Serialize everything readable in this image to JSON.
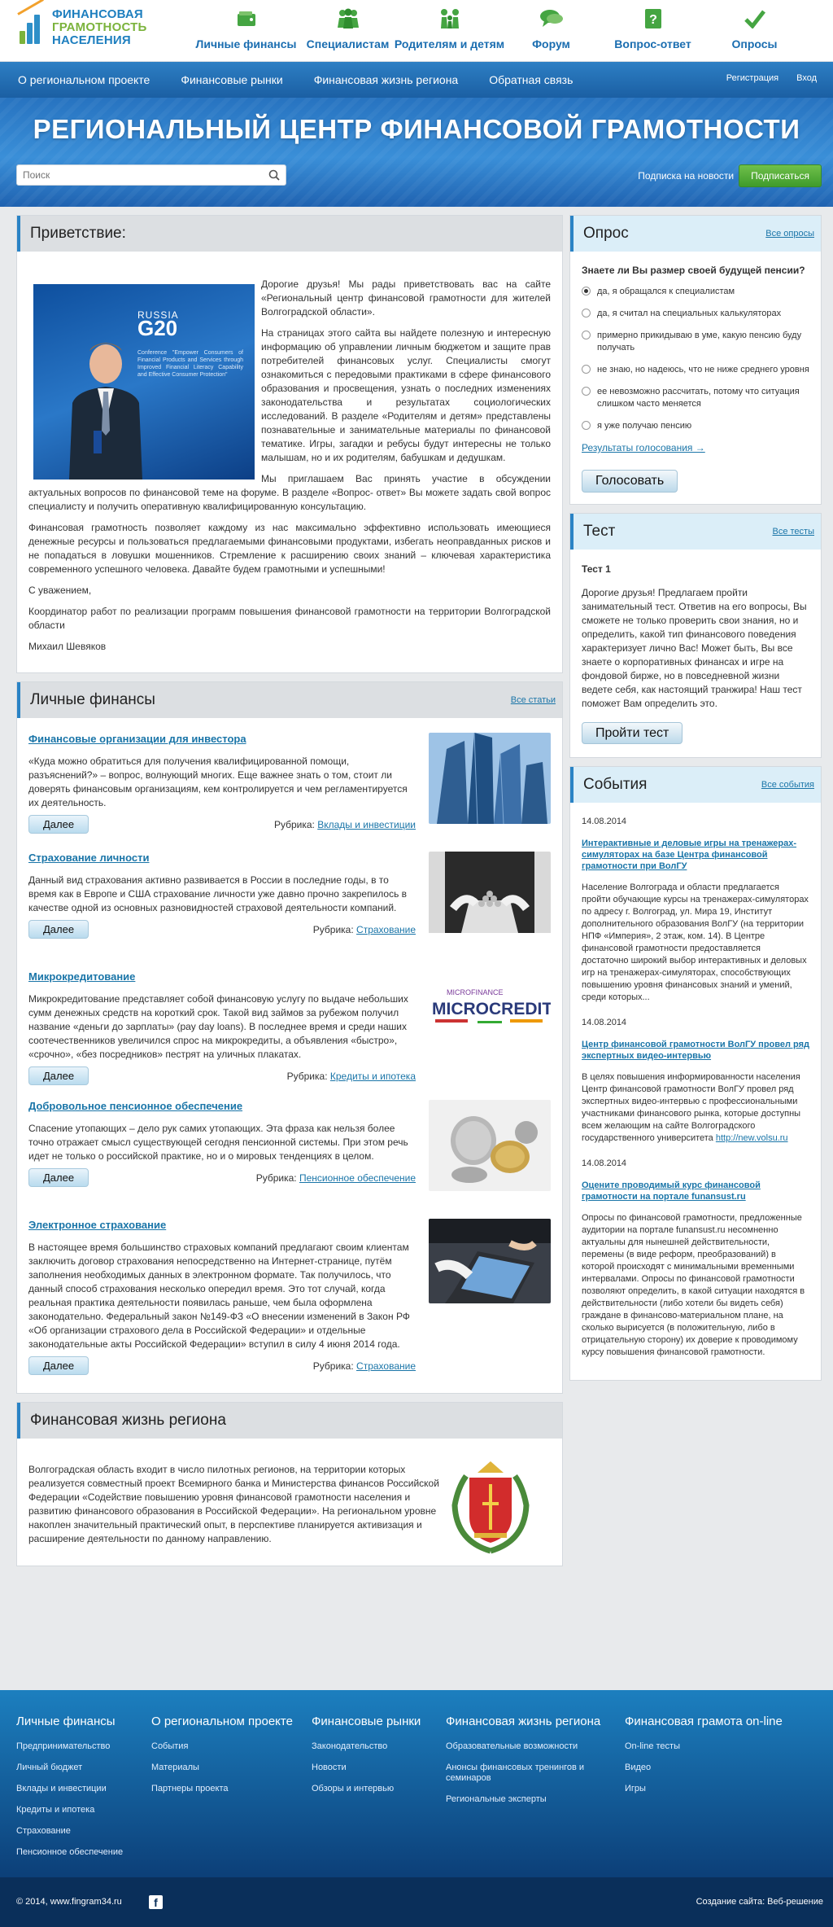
{
  "logo": {
    "line1": "ФИНАНСОВАЯ",
    "line2": "ГРАМОТНОСТЬ",
    "line3": "НАСЕЛЕНИЯ"
  },
  "topnav": [
    {
      "label": "Личные финансы",
      "icon": "wallet-icon"
    },
    {
      "label": "Специалистам",
      "icon": "people-group-icon"
    },
    {
      "label": "Родителям и детям",
      "icon": "family-icon"
    },
    {
      "label": "Форум",
      "icon": "chat-icon"
    },
    {
      "label": "Вопрос-ответ",
      "icon": "question-icon"
    },
    {
      "label": "Опросы",
      "icon": "checkmark-icon"
    }
  ],
  "navbar": {
    "items": [
      "О региональном проекте",
      "Финансовые рынки",
      "Финансовая жизнь региона",
      "Обратная связь"
    ],
    "register": "Регистрация",
    "login": "Вход"
  },
  "banner": {
    "title": "РЕГИОНАЛЬНЫЙ ЦЕНТР ФИНАНСОВОЙ ГРАМОТНОСТИ",
    "search_placeholder": "Поиск",
    "subscribe_label": "Подписка на новости",
    "subscribe_button": "Подписаться"
  },
  "welcome": {
    "title": "Приветствие:",
    "photo": {
      "rus": "RUSSIA",
      "g20": "G20",
      "conf": "Conference \"Empower Consumers of Financial Products and Services through Improved Financial Literacy Capability and Effective Consumer Protection\""
    },
    "p1": "Дорогие друзья! Мы рады приветствовать вас на сайте «Региональный центр финансовой грамотности для жителей Волгоградской области».",
    "p2": "На страницах этого сайта вы найдете полезную и интересную информацию об управлении личным бюджетом и защите прав потребителей финансовых услуг. Специалисты смогут ознакомиться с передовыми практиками в сфере финансового образования и просвещения, узнать о последних изменениях законодательства и результатах социологических исследований. В разделе «Родителям и детям» представлены познавательные и занимательные материалы по финансовой тематике. Игры, загадки и ребусы будут интересны не только малышам, но и их родителям, бабушкам и дедушкам.",
    "p3": "Мы приглашаем Вас принять участие в обсуждении актуальных вопросов по финансовой теме на форуме. В разделе «Вопрос- ответ» Вы можете задать свой вопрос специалисту и получить оперативную квалифицированную консультацию.",
    "p4": "Финансовая грамотность позволяет каждому из нас максимально эффективно использовать имеющиеся денежные ресурсы и пользоваться предлагаемыми финансовыми продуктами, избегать неоправданных рисков и не попадаться в ловушки мошенников. Стремление к расширению своих знаний – ключевая характеристика современного успешного человека. Давайте будем грамотными и успешными!",
    "p5": "С уважением,",
    "p6": "Координатор работ по реализации программ повышения финансовой грамотности на территории Волгоградской области",
    "p7": "Михаил Шевяков"
  },
  "personal": {
    "title": "Личные финансы",
    "all": "Все статьи",
    "more": "Далее",
    "rubric_label": "Рубрика:",
    "articles": [
      {
        "title": "Финансовые организации для инвестора",
        "text": "«Куда можно обратиться для получения квалифицированной помощи, разъяснений?» – вопрос, волнующий многих. Еще важнее знать о том, стоит ли доверять финансовым организациям, кем контролируется и чем регламентируется их деятельность.",
        "rubric": "Вклады и инвестиции"
      },
      {
        "title": "Страхование личности",
        "text": "Данный вид страхования активно развивается в России в последние годы, в то время как в Европе и США страхование личности уже давно прочно закрепилось в качестве одной из основных разновидностей страховой деятельности компаний.",
        "rubric": "Страхование"
      },
      {
        "title": "Микрокредитование",
        "text": "Микрокредитование представляет собой финансовую услугу по выдаче небольших сумм денежных средств на короткий срок. Такой вид займов за рубежом получил название «деньги до зарплаты» (pay day loans). В последнее время и среди наших соотечественников увеличился спрос на микрокредиты, а объявления «быстро», «срочно», «без посредников» пестрят на уличных плакатах.",
        "rubric": "Кредиты и ипотека",
        "img_text1": "MICROFINANCE",
        "img_text2": "MICROCREDIT"
      },
      {
        "title": "Добровольное пенсионное обеспечение",
        "text": "Спасение утопающих – дело рук самих утопающих. Эта фраза как нельзя более точно отражает смысл существующей сегодня пенсионной системы. При этом речь идет не только о российской практике, но и о мировых тенденциях в целом.",
        "rubric": "Пенсионное обеспечение"
      },
      {
        "title": "Электронное страхование",
        "text": "В настоящее время большинство страховых компаний предлагают своим клиентам заключить договор страхования непосредственно на Интернет-странице, путём заполнения необходимых данных в электронном формате. Так получилось, что данный способ страхования несколько опередил время. Это тот случай, когда реальная практика деятельности появилась раньше, чем была оформлена законодательно. Федеральный закон №149-ФЗ «О внесении изменений в Закон РФ «Об организации страхового дела в Российской Федерации» и отдельные законодательные акты Российской Федерации» вступил в силу 4 июня 2014 года.",
        "rubric": "Страхование"
      }
    ]
  },
  "region": {
    "title": "Финансовая жизнь региона",
    "text": "Волгоградская область входит в число пилотных регионов, на территории которых реализуется совместный проект Всемирного банка и Министерства финансов Российской Федерации «Содействие повышению уровня финансовой грамотности населения и развитию финансового образования в Российской Федерации». На региональном уровне накоплен значительный практический опыт, в перспективе планируется активизация и расширение деятельности по данному направлению."
  },
  "poll": {
    "title": "Опрос",
    "all": "Все опросы",
    "question": "Знаете ли Вы размер своей будущей пенсии?",
    "options": [
      "да, я обращался к специалистам",
      "да, я считал на специальных калькуляторах",
      "примерно прикидываю в уме, какую пенсию буду получать",
      "не знаю, но надеюсь, что не ниже среднего уровня",
      "ее невозможно рассчитать, потому что ситуация слишком часто меняется",
      "я уже получаю пенсию"
    ],
    "selected": 0,
    "results": "Результаты голосования →",
    "vote": "Голосовать"
  },
  "test": {
    "title": "Тест",
    "all": "Все тесты",
    "name": "Тест 1",
    "text": "Дорогие друзья! Предлагаем пройти занимательный тест. Ответив на его вопросы, Вы сможете не только проверить свои знания, но и определить, какой тип финансового поведения характеризует лично Вас! Может быть, Вы все знаете о корпоративных финансах и игре на фондовой бирже, но в повседневной жизни ведете себя, как настоящий транжира! Наш тест поможет Вам определить это.",
    "button": "Пройти тест"
  },
  "events": {
    "title": "События",
    "all": "Все события",
    "items": [
      {
        "date": "14.08.2014",
        "title": "Интерактивные и деловые игры на тренажерах-симуляторах на базе Центра финансовой грамотности при ВолГУ",
        "text": "Население Волгограда и области предлагается пройти обучающие курсы на тренажерах-симуляторах по адресу г. Волгоград, ул. Мира 19, Институт дополнительного образования ВолГУ (на территории НПФ «Империя», 2 этаж, ком. 14). В Центре финансовой грамотности предоставляется достаточно широкий выбор интерактивных и деловых игр на тренажерах-симуляторах, способствующих повышению уровня финансовых знаний и умений, среди которых..."
      },
      {
        "date": "14.08.2014",
        "title": "Центр финансовой грамотности ВолГУ провел ряд экспертных видео-интервью",
        "text": "В целях повышения информированности населения Центр финансовой грамотности ВолГУ провел ряд экспертных видео-интервью с профессиональными участниками финансового рынка, которые доступны всем желающим на сайте Волгоградского государственного университета",
        "link": "http://new.volsu.ru"
      },
      {
        "date": "14.08.2014",
        "title": "Оцените проводимый курс финансовой грамотности на портале funansust.ru",
        "text": "Опросы по финансовой грамотности, предложенные аудитории на портале funansust.ru несомненно актуальны для нынешней действительности, перемены (в виде реформ, преобразований) в которой происходят с минимальными временными интервалами. Опросы по финансовой грамотности позволяют определить, в какой ситуации находятся в действительности (либо хотели бы видеть себя) граждане в финансово-материальном плане, на сколько вырисуется (в положительную, либо в отрицательную сторону) их доверие к проводимому курсу повышения финансовой грамотности."
      }
    ]
  },
  "footer": {
    "cols": [
      {
        "h": "Личные финансы",
        "links": [
          "Предпринимательство",
          "Личный бюджет",
          "Вклады и инвестиции",
          "Кредиты и ипотека",
          "Страхование",
          "Пенсионное обеспечение"
        ]
      },
      {
        "h": "О региональном проекте",
        "links": [
          "События",
          "Материалы",
          "Партнеры проекта"
        ]
      },
      {
        "h": "Финансовые рынки",
        "links": [
          "Законодательство",
          "Новости",
          "Обзоры и интервью"
        ]
      },
      {
        "h": "Финансовая жизнь региона",
        "links": [
          "Образовательные возможности",
          "Анонсы финансовых тренингов и семинаров",
          "Региональные эксперты"
        ]
      },
      {
        "h": "Финансовая грамота on-line",
        "links": [
          "On-line тесты",
          "Видео",
          "Игры"
        ]
      }
    ],
    "copyright": "© 2014, www.fingram34.ru",
    "developer": "Создание сайта: Веб-решение"
  },
  "colors": {
    "brand_blue": "#1d68ad",
    "accent_green": "#3f9b2b",
    "link": "#1a75a8"
  }
}
